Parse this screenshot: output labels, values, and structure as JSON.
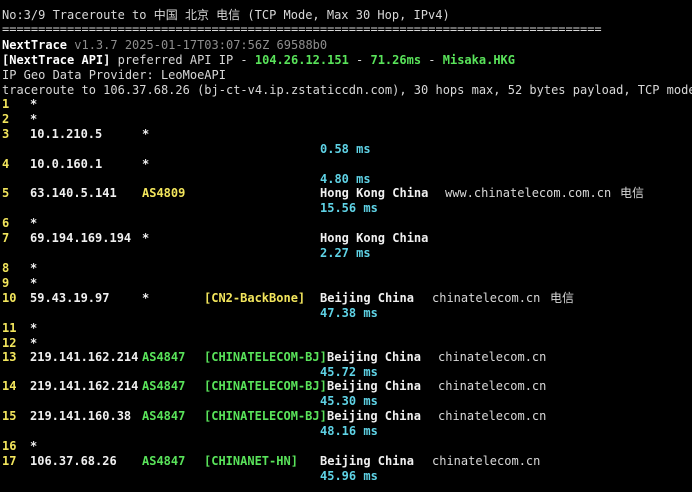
{
  "header": {
    "title": "No:3/9 Traceroute to 中国 北京 电信 (TCP Mode, Max 30 Hop, IPv4)",
    "separator": "==================================================================================="
  },
  "nexttrace": {
    "name": "NextTrace",
    "version": " v1.3.7 2025-01-17T03:07:56Z 69588b0",
    "api_label": "[NextTrace API]",
    "api_pre": " preferred API IP - ",
    "api_ip": "104.26.12.151",
    "api_sep1": " - ",
    "api_ms": "71.26ms",
    "api_sep2": " - ",
    "api_node": "Misaka.HKG",
    "geo_provider": "IP Geo Data Provider: LeoMoeAPI",
    "traceroute_line": "traceroute to 106.37.68.26 (bj-ct-v4.ip.zstaticcdn.com), 30 hops max, 52 bytes payload, TCP mode"
  },
  "colors": {
    "background": "#000000",
    "hop_number": "#f2e55c",
    "asn": "#59e35a",
    "latency": "#5fd3e6",
    "backbone_tag": "#f2e55c"
  },
  "hops": [
    {
      "n": "1",
      "ip": "*"
    },
    {
      "n": "2",
      "ip": "*"
    },
    {
      "n": "3",
      "ip": "10.1.210.5",
      "asn": "*",
      "ms": "0.58 ms"
    },
    {
      "n": "4",
      "ip": "10.0.160.1",
      "asn": "*",
      "ms": "4.80 ms"
    },
    {
      "n": "5",
      "ip": "63.140.5.141",
      "asn": "AS4809",
      "geo": "Hong Kong China",
      "domain": "www.chinatelecom.com.cn",
      "isp": "电信",
      "ms": "15.56 ms"
    },
    {
      "n": "6",
      "ip": "*"
    },
    {
      "n": "7",
      "ip": "69.194.169.194",
      "asn": "*",
      "geo": "Hong Kong China",
      "ms": "2.27 ms"
    },
    {
      "n": "8",
      "ip": "*"
    },
    {
      "n": "9",
      "ip": "*"
    },
    {
      "n": "10",
      "ip": "59.43.19.97",
      "asn": "*",
      "tag": "[CN2-BackBone]",
      "geo": "Beijing China",
      "domain": "chinatelecom.cn",
      "isp": "电信",
      "ms": "47.38 ms"
    },
    {
      "n": "11",
      "ip": "*"
    },
    {
      "n": "12",
      "ip": "*"
    },
    {
      "n": "13",
      "ip": "219.141.162.214",
      "asn": "AS4847",
      "tag": "[CHINATELECOM-BJ]",
      "geo": "Beijing China",
      "domain": "chinatelecom.cn",
      "ms": "45.72 ms"
    },
    {
      "n": "14",
      "ip": "219.141.162.214",
      "asn": "AS4847",
      "tag": "[CHINATELECOM-BJ]",
      "geo": "Beijing China",
      "domain": "chinatelecom.cn",
      "ms": "45.30 ms"
    },
    {
      "n": "15",
      "ip": "219.141.160.38",
      "asn": "AS4847",
      "tag": "[CHINATELECOM-BJ]",
      "geo": "Beijing China",
      "domain": "chinatelecom.cn",
      "ms": "48.16 ms"
    },
    {
      "n": "16",
      "ip": "*"
    },
    {
      "n": "17",
      "ip": "106.37.68.26",
      "asn": "AS4847",
      "tag": "[CHINANET-HN]",
      "geo": "Beijing China",
      "domain": "chinatelecom.cn",
      "ms": "45.96 ms"
    }
  ]
}
